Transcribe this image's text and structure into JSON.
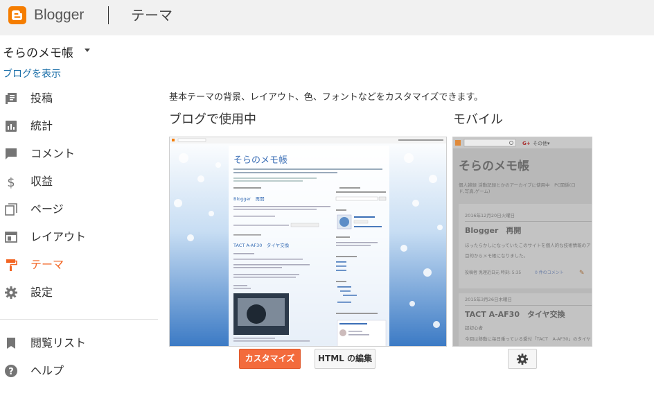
{
  "header": {
    "brand": "Blogger",
    "section": "テーマ"
  },
  "sidebar": {
    "blog_name": "そらのメモ帳",
    "view_blog": "ブログを表示",
    "items": [
      {
        "label": "投稿",
        "icon": "posts-icon"
      },
      {
        "label": "統計",
        "icon": "stats-icon"
      },
      {
        "label": "コメント",
        "icon": "comment-icon"
      },
      {
        "label": "収益",
        "icon": "dollar-icon"
      },
      {
        "label": "ページ",
        "icon": "pages-icon"
      },
      {
        "label": "レイアウト",
        "icon": "layout-icon"
      },
      {
        "label": "テーマ",
        "icon": "paint-roller-icon",
        "active": true
      },
      {
        "label": "設定",
        "icon": "gear-icon"
      }
    ],
    "extra_items": [
      {
        "label": "閲覧リスト",
        "icon": "bookmark-icon"
      },
      {
        "label": "ヘルプ",
        "icon": "help-icon"
      }
    ]
  },
  "main": {
    "intro": "基本テーマの背景、レイアウト、色、フォントなどをカスタマイズできます。",
    "desktop_title": "ブログで使用中",
    "mobile_title": "モバイル",
    "customize_button": "カスタマイズ",
    "edit_html_button": "HTML の編集",
    "desktop_preview": {
      "blog_title": "そらのメモ帳",
      "post1_title": "Blogger　再開",
      "post2_title": "TACT A-AF30　タイヤ交換"
    },
    "mobile_preview": {
      "search_placeholder": "",
      "blog_title": "そらのメモ帳",
      "description": "個人雑録 活動記録とかのアーカイブに使用中　PC関係(ロ",
      "description2": "ド,写真,ゲーム)",
      "date1": "2016年12月20日火曜日",
      "post1_title": "Blogger　再開",
      "post1_body1": "ほったらかしになっていたこのサイトを個人的な技術情報のア",
      "post1_body2": "目的からメモ帳になりました。",
      "post1_meta_author": "投稿者 兎理近日元 時刻: 5:35",
      "post1_meta_comments": "0 件のコメント",
      "date2": "2015年3月26日木曜日",
      "post2_title": "TACT A-AF30　タイヤ交換",
      "post2_body1": "超初心者",
      "post2_body2": "今回は移動に毎日乗っている愛付「TACT　A-AF30」のタイヤ"
    }
  },
  "colors": {
    "accent": "#f26422",
    "brand": "#f57d00",
    "link": "#1a6ea8"
  }
}
